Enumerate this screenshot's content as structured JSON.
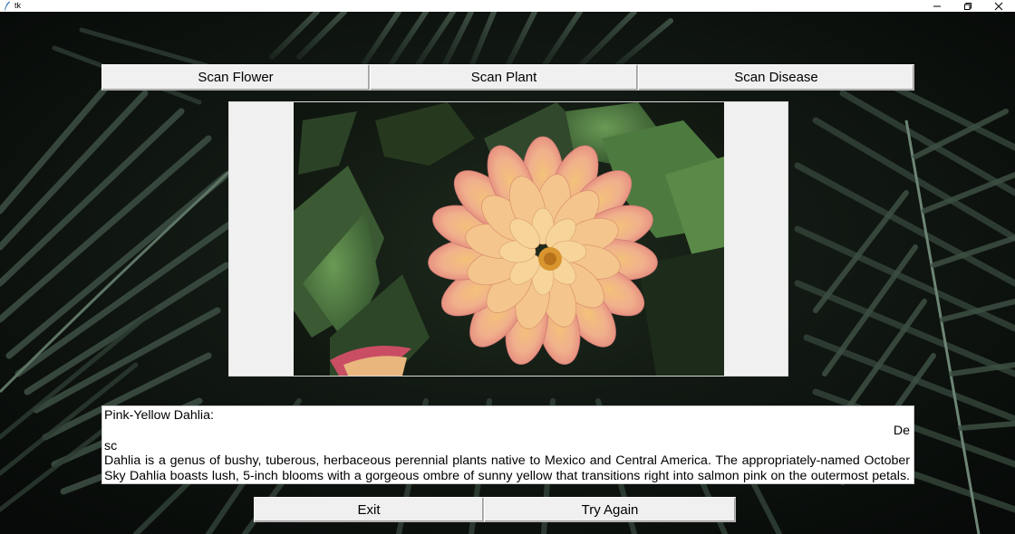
{
  "window": {
    "title": "tk",
    "icon": "feather-icon",
    "controls": [
      "minimize-icon",
      "maximize-icon",
      "close-icon"
    ]
  },
  "toolbar": {
    "scan_flower_label": "Scan Flower",
    "scan_plant_label": "Scan Plant",
    "scan_disease_label": "Scan Disease"
  },
  "result": {
    "title_line": "Pink-Yellow Dahlia:",
    "wrap_right": "De",
    "wrap_left": "sc",
    "line_1": "Dahlia is a genus of bushy, tuberous, herbaceous perennial plants native to Mexico and Central America. The appropriately-named October",
    "line_2": "Sky Dahlia boasts lush, 5-inch blooms with a gorgeous ombre of sunny yellow that transitions right into salmon pink on the outermost petals."
  },
  "actions": {
    "exit_label": "Exit",
    "try_again_label": "Try Again"
  },
  "colors": {
    "button_face": "#f0f0f0",
    "background": "#0d120e",
    "panel": "#f0f0f0"
  }
}
